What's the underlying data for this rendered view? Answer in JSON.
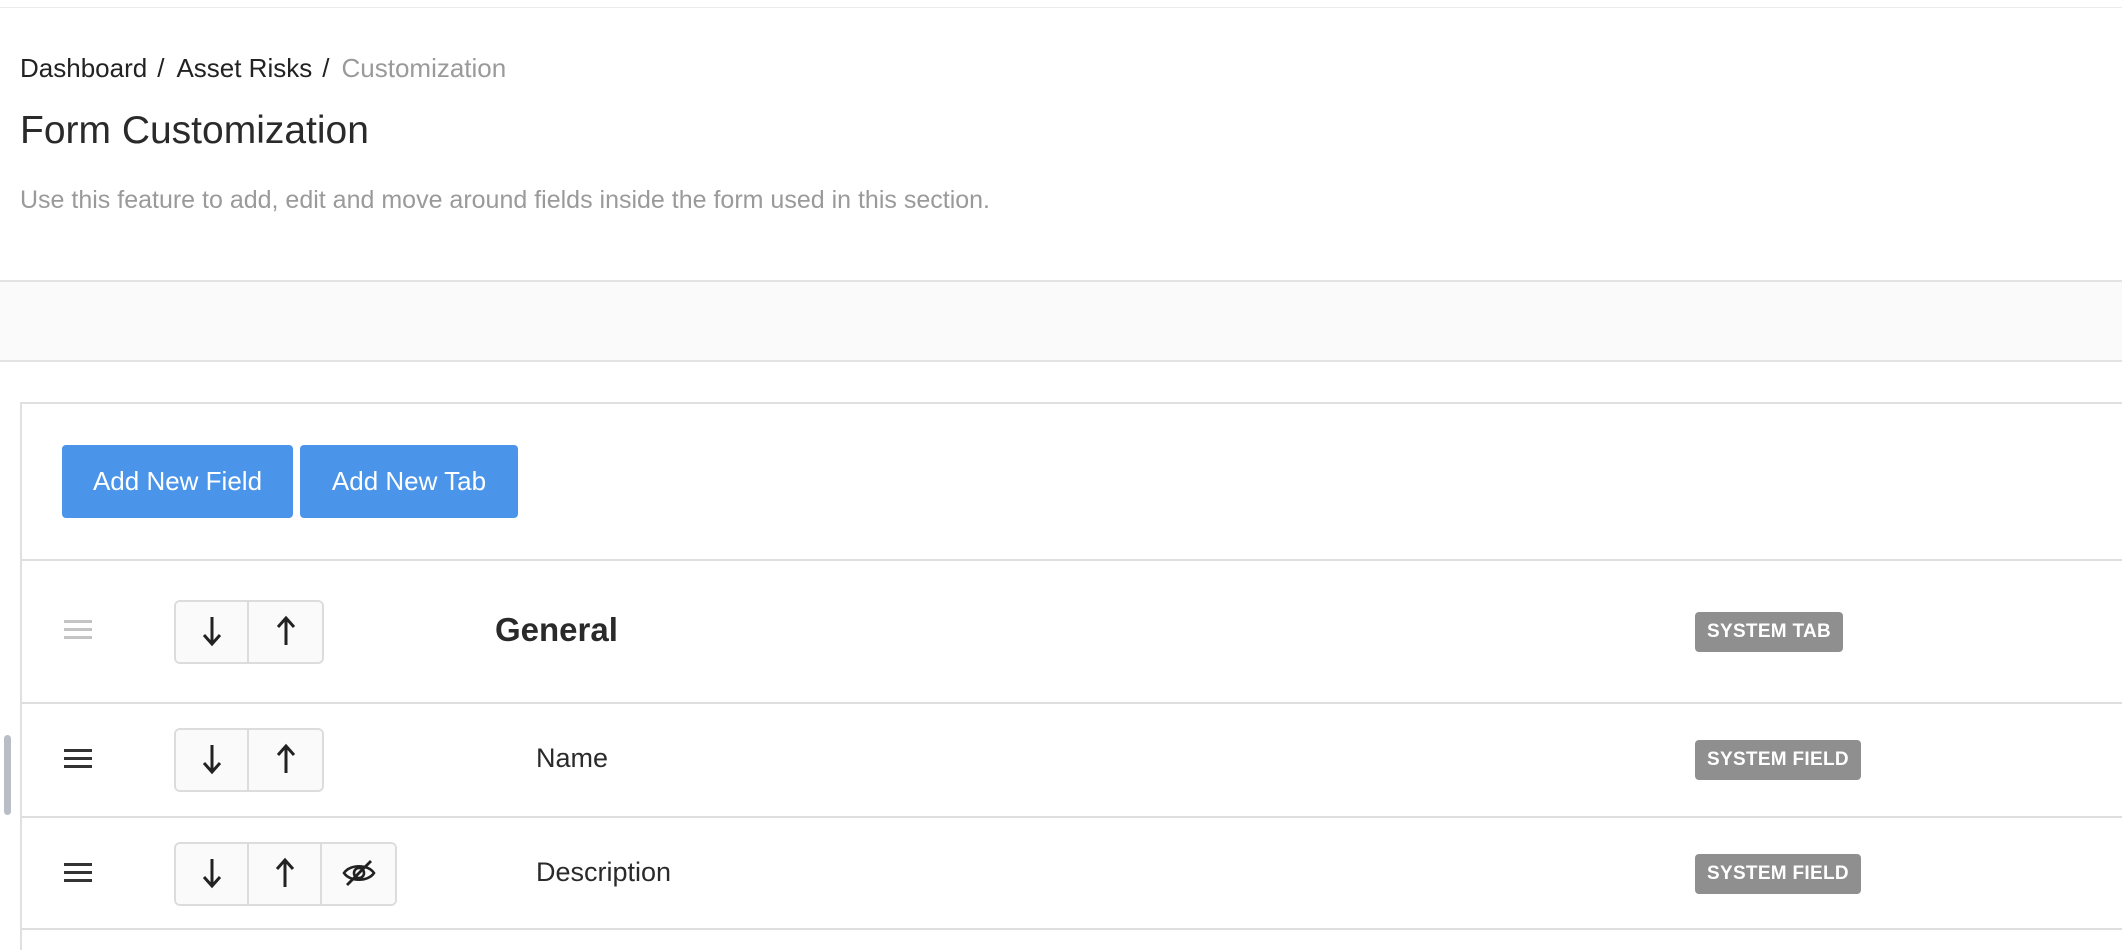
{
  "breadcrumb": {
    "items": [
      "Dashboard",
      "Asset Risks"
    ],
    "separator": "/",
    "current": "Customization"
  },
  "header": {
    "title": "Form Customization",
    "description": "Use this feature to add, edit and move around fields inside the form used in this section."
  },
  "actions": {
    "add_field_label": "Add New Field",
    "add_tab_label": "Add New Tab"
  },
  "colors": {
    "primary": "#4a94ea",
    "badge": "#8f8f8f",
    "muted_text": "#9a9a9a"
  },
  "rows": [
    {
      "kind": "tab",
      "name": "General",
      "badge": "SYSTEM TAB",
      "controls": [
        "arrow-down-icon",
        "arrow-up-icon"
      ]
    },
    {
      "kind": "field",
      "name": "Name",
      "badge": "SYSTEM FIELD",
      "controls": [
        "arrow-down-icon",
        "arrow-up-icon"
      ]
    },
    {
      "kind": "field",
      "name": "Description",
      "badge": "SYSTEM FIELD",
      "controls": [
        "arrow-down-icon",
        "arrow-up-icon",
        "eye-slash-icon"
      ]
    }
  ]
}
